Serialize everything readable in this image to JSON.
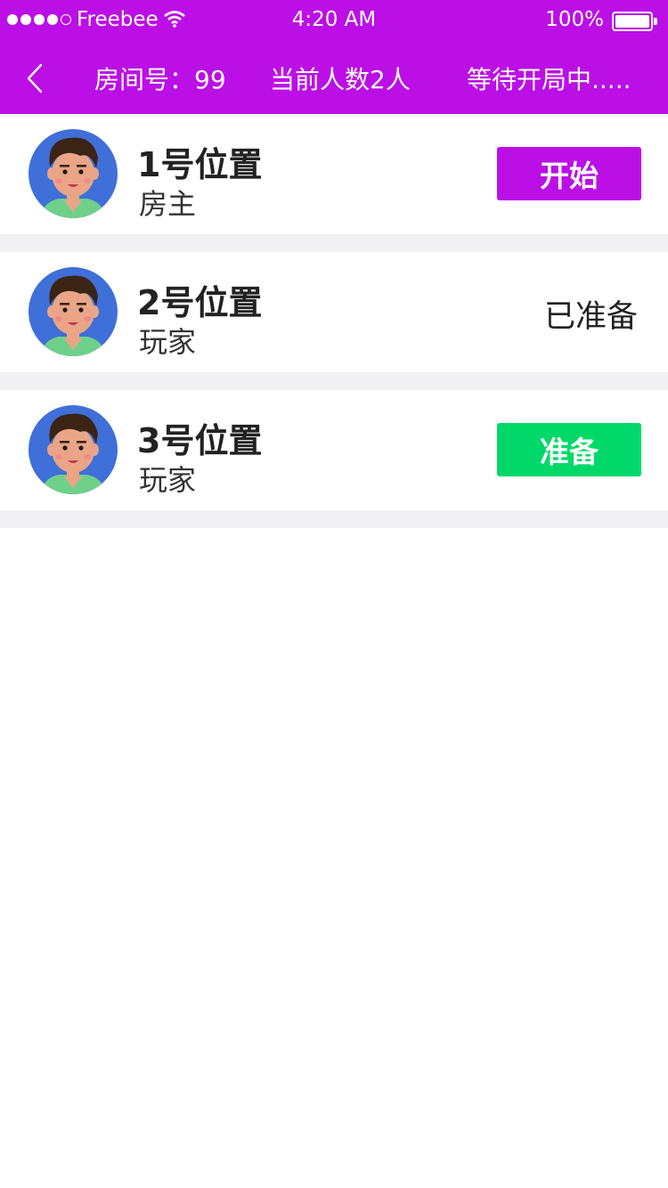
{
  "status_bar": {
    "carrier": "Freebee",
    "time": "4:20 AM",
    "battery": "100%"
  },
  "nav": {
    "room_label": "房间号：99",
    "player_count": "当前人数2人",
    "game_status": "等待开局中....."
  },
  "colors": {
    "header": "#bb0fe6",
    "start_button": "#bb0fe6",
    "ready_button": "#00d96a",
    "separator": "#f1f1f3"
  },
  "seats": [
    {
      "title": "1号位置",
      "role": "房主",
      "action_label": "开始",
      "action_type": "start-button"
    },
    {
      "title": "2号位置",
      "role": "玩家",
      "status_text": "已准备"
    },
    {
      "title": "3号位置",
      "role": "玩家",
      "action_label": "准备",
      "action_type": "ready-button"
    }
  ]
}
